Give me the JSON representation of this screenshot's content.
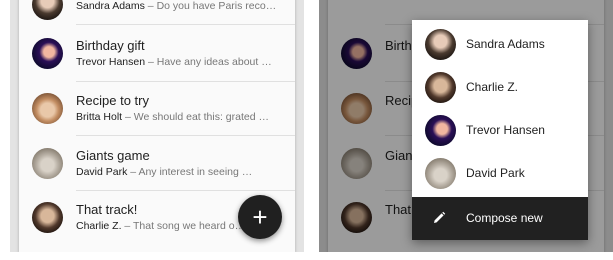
{
  "left": {
    "conversations": [
      {
        "title": "",
        "sender": "Sandra Adams",
        "snippet": " – Do you have Paris reco…"
      },
      {
        "title": "Birthday gift",
        "sender": "Trevor Hansen",
        "snippet": " – Have any ideas about …"
      },
      {
        "title": "Recipe to try",
        "sender": "Britta Holt",
        "snippet": " – We should eat this: grated …"
      },
      {
        "title": "Giants game",
        "sender": "David Park",
        "snippet": " – Any interest in seeing …"
      },
      {
        "title": "That track!",
        "sender": "Charlie Z.",
        "snippet": " – That song we heard o…"
      }
    ],
    "fab_label": "+"
  },
  "right": {
    "background_titles": [
      "Birth",
      "Recip",
      "Giant",
      "That t"
    ],
    "menu": {
      "contacts": [
        "Sandra Adams",
        "Charlie Z.",
        "Trevor Hansen",
        "David Park"
      ],
      "compose_label": "Compose new",
      "compose_icon": "pencil-icon"
    }
  }
}
